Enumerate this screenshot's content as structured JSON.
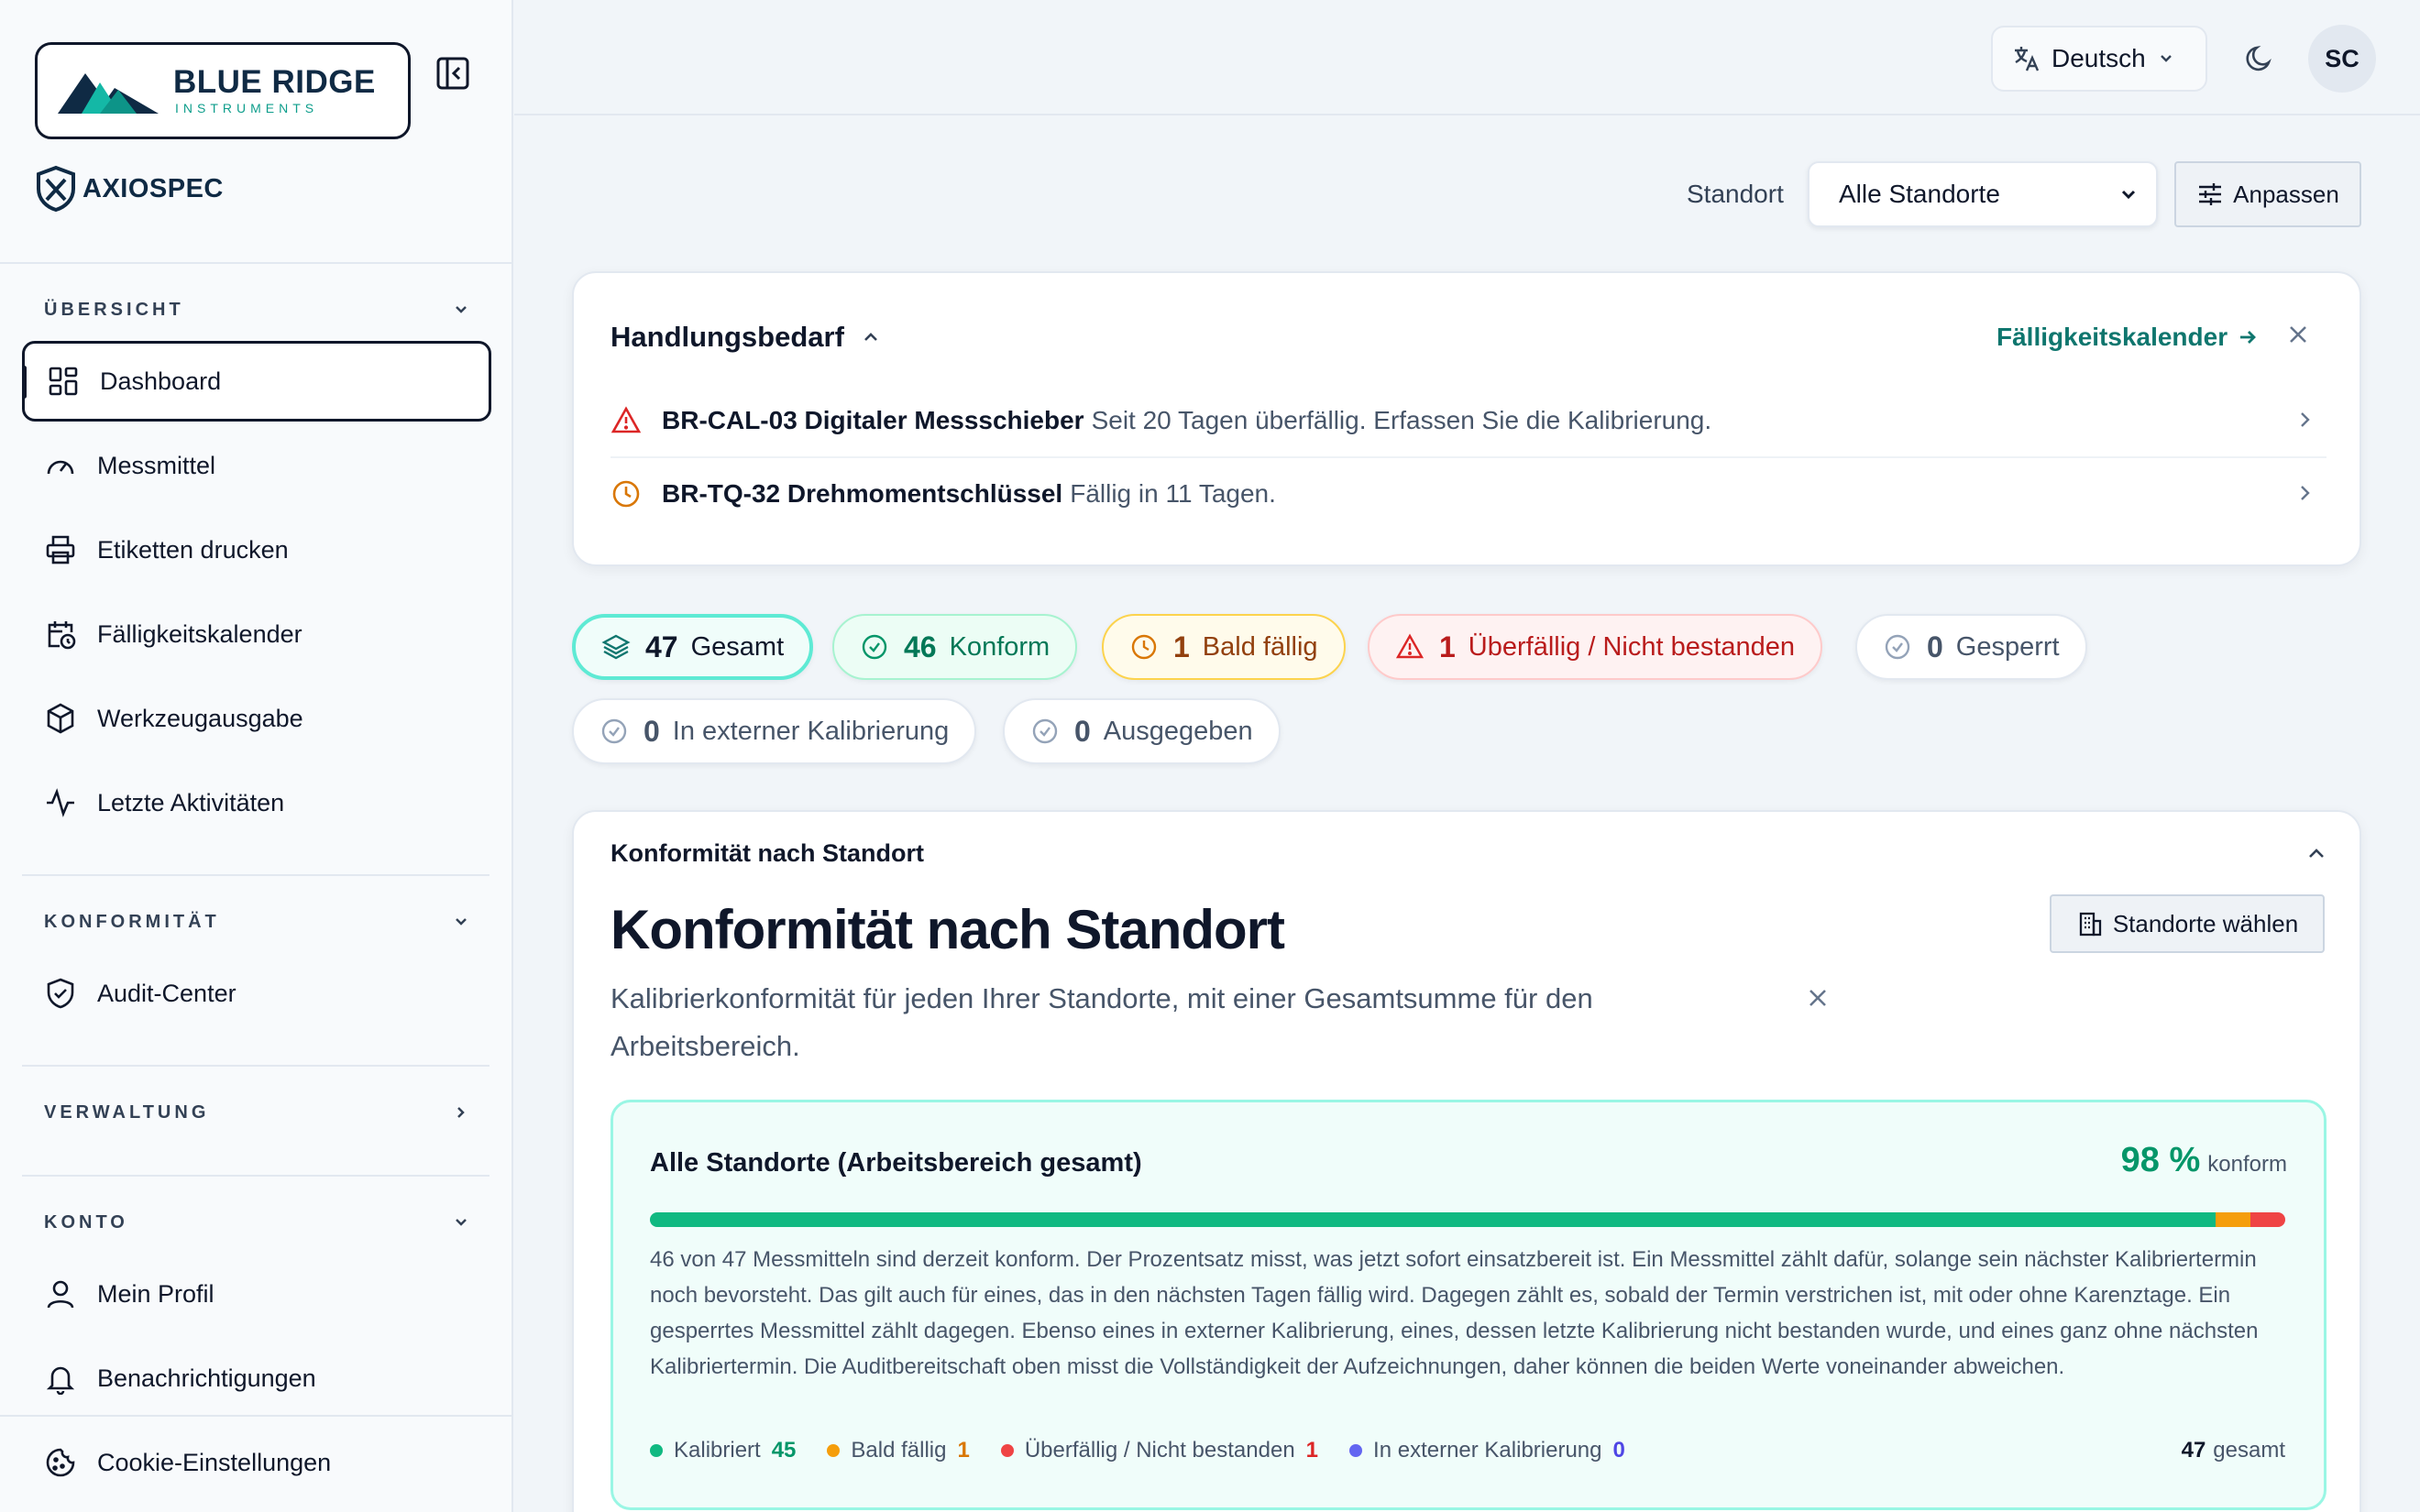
{
  "brand": {
    "name": "BLUE RIDGE",
    "sub": "INSTRUMENTS",
    "product": "AXIOSPEC"
  },
  "sidebar": {
    "sections": [
      {
        "title": "ÜBERSICHT",
        "expanded": true
      },
      {
        "title": "KONFORMITÄT",
        "expanded": true
      },
      {
        "title": "VERWALTUNG",
        "expanded": false
      },
      {
        "title": "KONTO",
        "expanded": true
      }
    ],
    "items": [
      {
        "label": "Dashboard",
        "icon": "dashboard-icon",
        "active": true
      },
      {
        "label": "Messmittel",
        "icon": "gauge-icon"
      },
      {
        "label": "Etiketten drucken",
        "icon": "printer-icon"
      },
      {
        "label": "Fälligkeitskalender",
        "icon": "calendar-clock-icon"
      },
      {
        "label": "Werkzeugausgabe",
        "icon": "package-icon"
      },
      {
        "label": "Letzte Aktivitäten",
        "icon": "activity-icon"
      },
      {
        "label": "Audit-Center",
        "icon": "shield-check-icon"
      },
      {
        "label": "Mein Profil",
        "icon": "user-icon"
      },
      {
        "label": "Benachrichtigungen",
        "icon": "bell-icon"
      },
      {
        "label": "Cookie-Einstellungen",
        "icon": "cookie-icon"
      }
    ]
  },
  "topbar": {
    "language": "Deutsch",
    "avatar_initials": "SC"
  },
  "filter": {
    "label": "Standort",
    "selected": "Alle Standorte",
    "customize_label": "Anpassen"
  },
  "action": {
    "title": "Handlungsbedarf",
    "link": "Fälligkeitskalender",
    "rows": [
      {
        "id": "BR-CAL-03 Digitaler Messschieber",
        "msg": "Seit 20 Tagen überfällig. Erfassen Sie die Kalibrierung.",
        "icon": "alert-triangle-icon"
      },
      {
        "id": "BR-TQ-32 Drehmomentschlüssel",
        "msg": "Fällig in 11 Tagen.",
        "icon": "clock-icon"
      }
    ]
  },
  "pills": [
    {
      "num": "47",
      "label": "Gesamt",
      "icon": "layers-icon"
    },
    {
      "num": "46",
      "label": "Konform",
      "icon": "check-circle-icon"
    },
    {
      "num": "1",
      "label": "Bald fällig",
      "icon": "clock-icon"
    },
    {
      "num": "1",
      "label": "Überfällig / Nicht bestanden",
      "icon": "alert-triangle-icon"
    },
    {
      "num": "0",
      "label": "Gesperrt",
      "icon": "check-circle-icon"
    },
    {
      "num": "0",
      "label": "In externer Kalibrierung",
      "icon": "check-circle-icon"
    },
    {
      "num": "0",
      "label": "Ausgegeben",
      "icon": "check-circle-icon"
    }
  ],
  "compliance": {
    "header": "Konformität nach Standort",
    "title": "Konformität nach Standort",
    "description": "Kalibrierkonformität für jeden Ihrer Standorte, mit einer Gesamtsumme für den Arbeitsbereich.",
    "choose_label": "Standorte wählen",
    "site": {
      "name": "Alle Standorte (Arbeitsbereich gesamt)",
      "pct": "98 %",
      "pct_unit": "konform",
      "explanation": "46 von 47 Messmitteln sind derzeit konform. Der Prozentsatz misst, was jetzt sofort einsatzbereit ist. Ein Messmittel zählt dafür, solange sein nächster Kalibriertermin noch bevorsteht. Das gilt auch für eines, das in den nächsten Tagen fällig wird. Dagegen zählt es, sobald der Termin verstrichen ist, mit oder ohne Karenztage. Ein gesperrtes Messmittel zählt dagegen. Ebenso eines in externer Kalibrierung, eines, dessen letzte Kalibrierung nicht bestanden wurde, und eines ganz ohne nächsten Kalibriertermin. Die Auditbereitschaft oben misst die Vollständigkeit der Aufzeichnungen, daher können die beiden Werte voneinander abweichen.",
      "legend": [
        {
          "label": "Kalibriert",
          "count": "45",
          "color": "#10b981",
          "value": 45
        },
        {
          "label": "Bald fällig",
          "count": "1",
          "color": "#f59e0b",
          "value": 1
        },
        {
          "label": "Überfällig / Nicht bestanden",
          "count": "1",
          "color": "#ef4444",
          "value": 1
        },
        {
          "label": "In externer Kalibrierung",
          "count": "0",
          "color": "#6366f1",
          "value": 0
        }
      ],
      "total_count": "47",
      "total_label": "gesamt"
    }
  },
  "colors": {
    "accent": "#0f766e",
    "ok": "#059669",
    "warn": "#d97706",
    "danger": "#dc2626"
  }
}
